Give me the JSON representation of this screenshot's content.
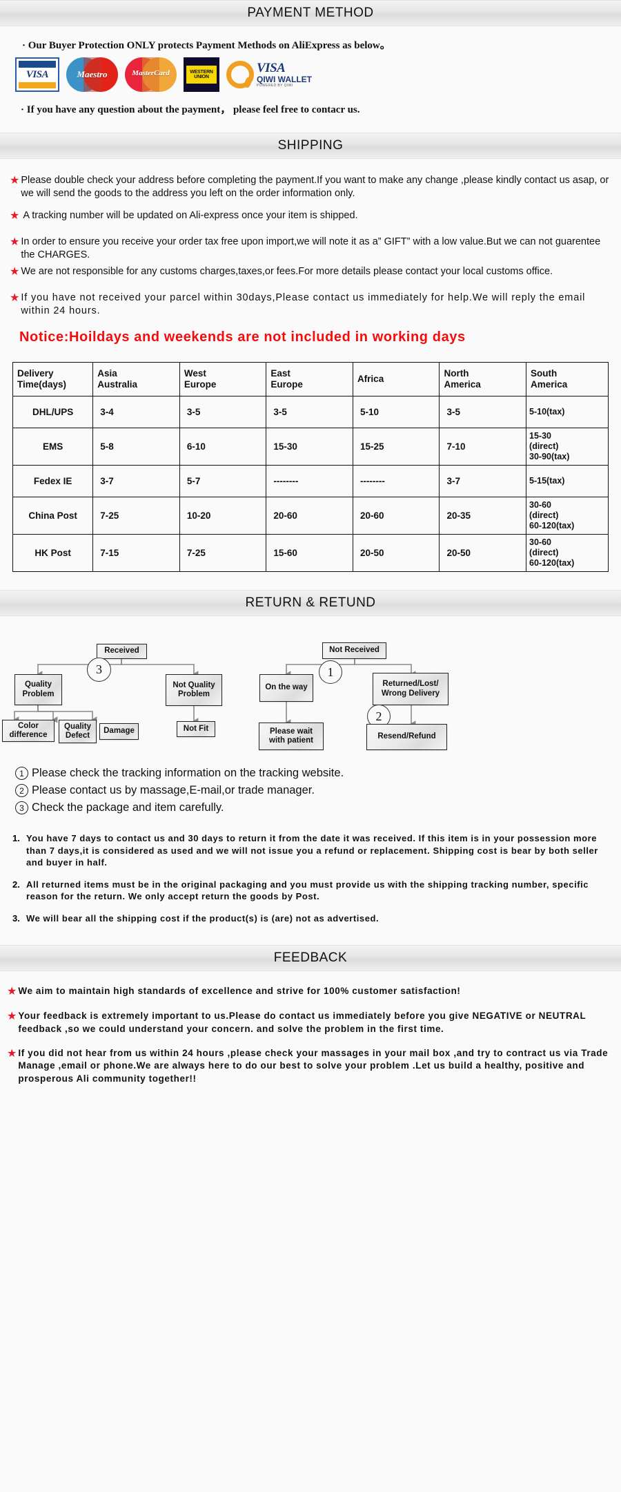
{
  "sections": {
    "payment_title": "PAYMENT METHOD",
    "shipping_title": "SHIPPING",
    "return_title": "RETURN & RETUND",
    "feedback_title": "FEEDBACK"
  },
  "payment": {
    "line1": "·  Our Buyer Protection ONLY protects Payment Methods on AliExpress as below。",
    "line2": "· If you have any question about the payment， please feel free to contacr us.",
    "logos": [
      {
        "name": "visa-logo",
        "label": "VISA"
      },
      {
        "name": "maestro-logo",
        "label": "Maestro"
      },
      {
        "name": "mastercard-logo",
        "label": "MasterCard"
      },
      {
        "name": "western-union-logo",
        "label_top": "WESTERN",
        "label_bottom": "UNION"
      },
      {
        "name": "qiwi-wallet-logo",
        "label1": "VISA",
        "label2": "QIWI WALLET",
        "label3": "POWERED BY QIWI"
      }
    ]
  },
  "shipping": {
    "bullets": [
      {
        "text": "Please double check your address before completing the payment.If you want to make any change ,please kindly contact us asap, or we will send the goods to the address you left on the order information only.",
        "spaced": false
      },
      {
        "text": "A tracking number will be updated on Ali-express once your item is shipped.",
        "spaced": false
      },
      {
        "text": "In order to ensure you receive your order tax free upon import,we will note it as a” GIFT” with a low value.But we can not guarentee the CHARGES.",
        "spaced": false
      },
      {
        "text": "We are not responsible for any customs charges,taxes,or fees.For more details please contact your local customs office.",
        "spaced": false
      },
      {
        "text": "If you have not received your parcel within 30days,Please contact us immediately for help.We will reply the email within 24 hours.",
        "spaced": true
      }
    ],
    "notice": "Notice:Hoildays and weekends are not included in working days",
    "table": {
      "headers": [
        "Delivery\nTime(days)",
        "Asia\nAustralia",
        "West\nEurope",
        "East\nEurope",
        "Africa",
        "North\nAmerica",
        "South\nAmerica"
      ],
      "rows": [
        {
          "label": "DHL/UPS",
          "cells": [
            "3-4",
            "3-5",
            "3-5",
            "5-10",
            "3-5",
            "5-10(tax)"
          ]
        },
        {
          "label": "EMS",
          "cells": [
            "5-8",
            "6-10",
            "15-30",
            "15-25",
            "7-10",
            "15-30\n(direct)\n30-90(tax)"
          ]
        },
        {
          "label": "Fedex IE",
          "cells": [
            "3-7",
            "5-7",
            "--------",
            "--------",
            "3-7",
            "5-15(tax)"
          ]
        },
        {
          "label": "China Post",
          "cells": [
            "7-25",
            "10-20",
            "20-60",
            "20-60",
            "20-35",
            "30-60\n(direct)\n60-120(tax)"
          ]
        },
        {
          "label": "HK Post",
          "cells": [
            "7-15",
            "7-25",
            "15-60",
            "20-50",
            "20-50",
            "30-60\n(direct)\n60-120(tax)"
          ]
        }
      ]
    }
  },
  "flowchart": {
    "nodes": {
      "received": "Received",
      "quality_problem": "Quality\nProblem",
      "not_quality_problem": "Not Quality\nProblem",
      "color_difference": "Color\ndifference",
      "quality_defect": "Quality\nDefect",
      "damage": "Damage",
      "not_fit": "Not Fit",
      "not_received": "Not  Received",
      "on_the_way": "On the way",
      "returned_lost": "Returned/Lost/\nWrong Delivery",
      "please_wait": "Please wait\nwith patient",
      "resend_refund": "Resend/Refund"
    },
    "markers": {
      "m1": "1",
      "m2": "2",
      "m3": "3"
    }
  },
  "return_notes": [
    {
      "num": "①",
      "text": "Please check the tracking information on the tracking website."
    },
    {
      "num": "②",
      "text": "Please contact us by  massage,E-mail,or trade manager."
    },
    {
      "num": "③",
      "text": "Check the package and item carefully."
    }
  ],
  "return_terms": [
    {
      "n": "1.",
      "text": "You have 7 days to contact us and 30 days to return it from the date it was received. If this item is in your possession more than 7 days,it is considered as used and we will not issue you a refund or replacement. Shipping cost is bear by both seller and buyer in half."
    },
    {
      "n": "2.",
      "text": "All returned items must be in the original packaging and you must provide us with the shipping tracking number, specific reason for the return. We only accept return the goods by Post."
    },
    {
      "n": "3.",
      "text": "We will bear all the shipping cost if the product(s) is (are) not as advertised."
    }
  ],
  "feedback": [
    {
      "text": "We aim to maintain high standards of excellence and strive  for 100% customer satisfaction!"
    },
    {
      "text": "Your feedback is extremely important to us.Please do contact us immediately before you give NEGATIVE or NEUTRAL feedback ,so  we could understand your concern. and solve the problem in the first time."
    },
    {
      "text": "If you did not hear from us within 24 hours ,please check your massages in your mail box ,and try to contract us via Trade Manage ,email or phone.We are always here to do our best to solve your problem .Let us build a healthy, positive and prosperous Ali community together!!"
    }
  ],
  "colors": {
    "star_red": "#e8192c",
    "notice_red": "#f40c0c",
    "bar_gray": "#e6e6e6"
  }
}
